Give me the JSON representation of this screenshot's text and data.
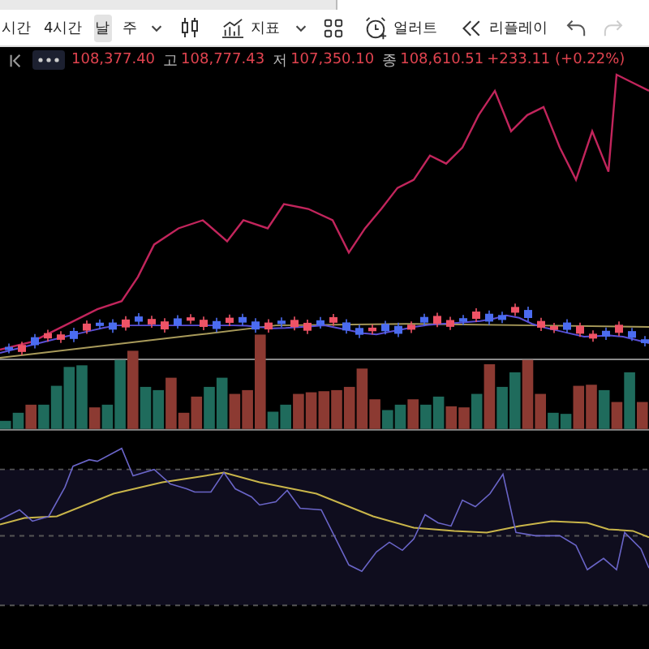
{
  "toolbar": [
    {
      "kind": "interval",
      "label": "시간",
      "selected": false
    },
    {
      "kind": "interval",
      "label": "4시간",
      "selected": false
    },
    {
      "kind": "interval",
      "label": "날",
      "selected": true
    },
    {
      "kind": "interval",
      "label": "주",
      "selected": false
    },
    {
      "kind": "dropdown"
    },
    {
      "kind": "candles"
    },
    {
      "kind": "indicators",
      "label": "지표"
    },
    {
      "kind": "dropdown"
    },
    {
      "kind": "layouts"
    },
    {
      "kind": "alert",
      "label": "얼러트"
    },
    {
      "kind": "replay",
      "label": "리플레이"
    },
    {
      "kind": "undo",
      "disabled": false
    },
    {
      "kind": "redo",
      "disabled": true
    }
  ],
  "legend": {
    "values": [
      {
        "value": "108,377.40"
      },
      {
        "label": "고",
        "value": "108,777.43"
      },
      {
        "label": "저",
        "value": "107,350.10"
      },
      {
        "label": "종",
        "value": "108,610.51"
      }
    ],
    "change": "+233.11 (+0.22%)"
  }
}
